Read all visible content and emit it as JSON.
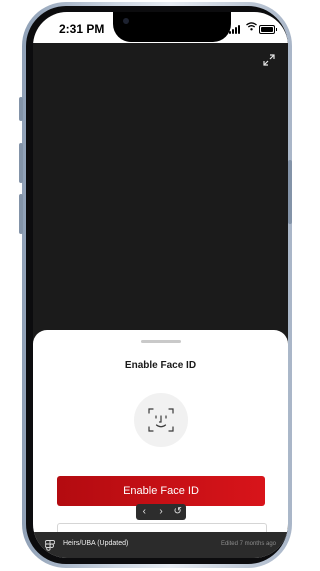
{
  "status_bar": {
    "time": "2:31 PM",
    "icons": [
      "signal-icon",
      "wifi-icon",
      "battery-icon"
    ]
  },
  "viewer": {
    "expand_icon": "expand-icon"
  },
  "sheet": {
    "title": "Enable Face ID",
    "face_icon": "face-id-icon",
    "primary_button_label": "Enable Face ID",
    "accent_color": "#c8101a"
  },
  "prototype_nav": {
    "back_icon": "chevron-left-icon",
    "forward_icon": "chevron-right-icon",
    "restart_icon": "restart-icon"
  },
  "footer": {
    "app_icon": "figma-icon",
    "file_name": "Heirs/UBA (Updated)",
    "edited": "Edited 7 months ago"
  }
}
